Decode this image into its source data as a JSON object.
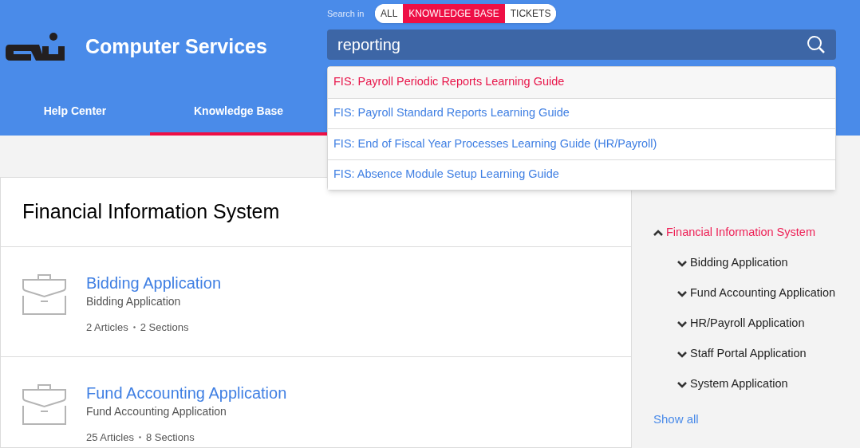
{
  "header": {
    "brand": "Computer Services",
    "nav": [
      {
        "label": "Help Center",
        "selected": false
      },
      {
        "label": "Knowledge Base",
        "selected": true
      }
    ]
  },
  "search": {
    "scope_label": "Search in",
    "scopes": [
      {
        "label": "ALL",
        "selected": false
      },
      {
        "label": "KNOWLEDGE BASE",
        "selected": true
      },
      {
        "label": "TICKETS",
        "selected": false
      }
    ],
    "value": "reporting",
    "suggestions": [
      {
        "label": "FIS: Payroll Periodic Reports Learning Guide",
        "selected": true
      },
      {
        "label": "FIS: Payroll Standard Reports Learning Guide",
        "selected": false
      },
      {
        "label": "FIS: End of Fiscal Year Processes Learning Guide (HR/Payroll)",
        "selected": false
      },
      {
        "label": "FIS: Absence Module Setup Learning Guide",
        "selected": false
      }
    ]
  },
  "category": {
    "title": "Financial Information System",
    "sections": [
      {
        "title": "Bidding Application",
        "description": "Bidding Application",
        "articles": "2 Articles",
        "sections": "2 Sections"
      },
      {
        "title": "Fund Accounting Application",
        "description": "Fund Accounting Application",
        "articles": "25 Articles",
        "sections": "8 Sections"
      }
    ]
  },
  "sidebar": {
    "tree": [
      {
        "label": "Financial Information System",
        "selected": true,
        "expanded": true,
        "children": [
          {
            "label": "Bidding Application",
            "selected": false,
            "expanded": false
          },
          {
            "label": "Fund Accounting Application",
            "selected": false,
            "expanded": false
          },
          {
            "label": "HR/Payroll Application",
            "selected": false,
            "expanded": false
          },
          {
            "label": "Staff Portal Application",
            "selected": false,
            "expanded": false
          },
          {
            "label": "System Application",
            "selected": false,
            "expanded": false
          }
        ]
      }
    ],
    "show_all": "Show all"
  }
}
